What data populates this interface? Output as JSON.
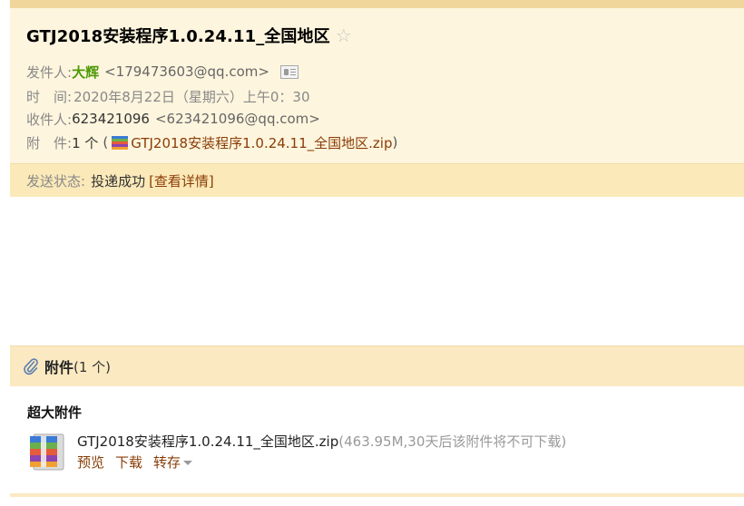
{
  "header": {
    "subject": "GTJ2018安装程序1.0.24.11_全国地区",
    "star_icon": "☆",
    "from_label": "发件人:",
    "from_name": "大辉",
    "from_address": "<179473603@qq.com>",
    "time_label": "时　间:",
    "time_value": "2020年8月22日（星期六）上午0：30",
    "to_label": "收件人:",
    "to_name": "623421096",
    "to_address": "<623421096@qq.com>",
    "attachment_label": "附　件:",
    "attachment_count": "1 个",
    "attachment_open_paren": "(",
    "attachment_name": "GTJ2018安装程序1.0.24.11_全国地区.zip",
    "attachment_close_paren": ")"
  },
  "status": {
    "label": "发送状态:",
    "value": "投递成功",
    "detail_link": "[查看详情]"
  },
  "attachments": {
    "title": "附件",
    "count": "(1 个)",
    "section_label": "超大附件",
    "files": [
      {
        "name": "GTJ2018安装程序1.0.24.11_全国地区.zip",
        "extra": "(463.95M,30天后该附件将不可下载)",
        "actions": {
          "preview": "预览",
          "download": "下载",
          "save": "转存"
        }
      }
    ]
  },
  "colors": {
    "header_bg": "#fef5de",
    "status_bg": "#fbe9b9",
    "link": "#8a3c05",
    "sender_name": "#4e9a06"
  }
}
